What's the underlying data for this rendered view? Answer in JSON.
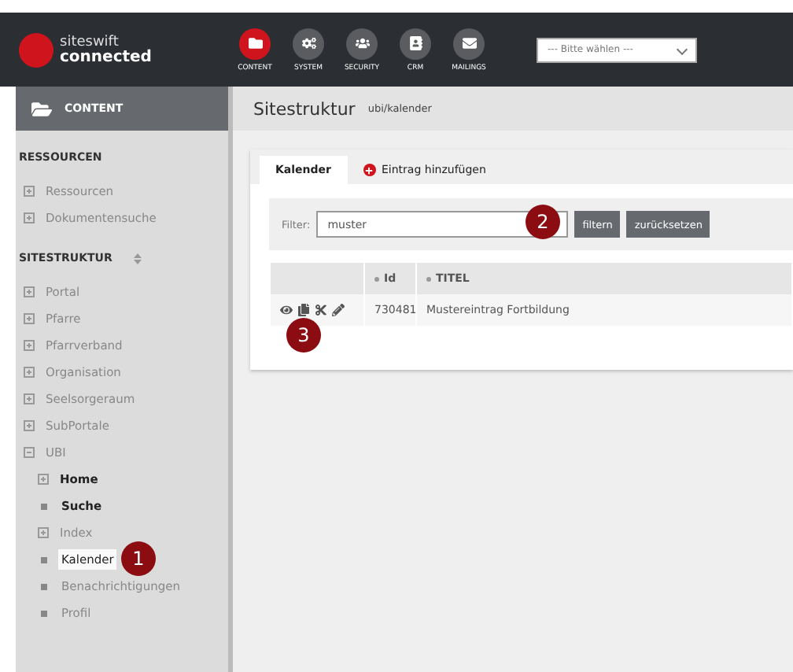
{
  "header": {
    "logo": {
      "line1": "siteswift",
      "line2": "connected"
    },
    "nav": [
      {
        "label": "CONTENT",
        "selected": true
      },
      {
        "label": "SYSTEM",
        "selected": false
      },
      {
        "label": "SECURITY",
        "selected": false
      },
      {
        "label": "CRM",
        "selected": false
      },
      {
        "label": "MAILINGS",
        "selected": false
      }
    ],
    "dropdown": {
      "value": "--- Bitte wählen ---"
    }
  },
  "sidebar": {
    "title": "CONTENT",
    "sections": [
      {
        "heading": "RESSOURCEN",
        "sortable": false,
        "items": [
          {
            "label": "Ressourcen",
            "kind": "expand",
            "bold": false,
            "selected": false
          },
          {
            "label": "Dokumentensuche",
            "kind": "expand",
            "bold": false,
            "selected": false
          }
        ]
      },
      {
        "heading": "SITESTRUKTUR",
        "sortable": true,
        "items": [
          {
            "label": "Portal",
            "kind": "expand",
            "bold": false,
            "selected": false
          },
          {
            "label": "Pfarre",
            "kind": "expand",
            "bold": false,
            "selected": false
          },
          {
            "label": "Pfarrverband",
            "kind": "expand",
            "bold": false,
            "selected": false
          },
          {
            "label": "Organisation",
            "kind": "expand",
            "bold": false,
            "selected": false
          },
          {
            "label": "Seelsorgeraum",
            "kind": "expand",
            "bold": false,
            "selected": false
          },
          {
            "label": "SubPortale",
            "kind": "expand",
            "bold": false,
            "selected": false
          },
          {
            "label": "UBI",
            "kind": "collapse",
            "bold": false,
            "selected": false,
            "children": [
              {
                "label": "Home",
                "kind": "expand",
                "bold": true,
                "selected": false
              },
              {
                "label": "Suche",
                "kind": "leaf",
                "bold": true,
                "selected": false
              },
              {
                "label": "Index",
                "kind": "expand",
                "bold": false,
                "selected": false
              },
              {
                "label": "Kalender",
                "kind": "leaf",
                "bold": false,
                "selected": true
              },
              {
                "label": "Benachrichtigungen",
                "kind": "leaf",
                "bold": false,
                "selected": false
              },
              {
                "label": "Profil",
                "kind": "leaf",
                "bold": false,
                "selected": false
              }
            ]
          }
        ]
      }
    ]
  },
  "content": {
    "title": "Sitestruktur",
    "path": "ubi/kalender",
    "tabs": [
      {
        "label": "Kalender",
        "kind": "tab",
        "selected": true
      },
      {
        "label": "Eintrag hinzufügen",
        "kind": "add",
        "selected": false
      }
    ],
    "filter": {
      "label": "Filter:",
      "value": "muster",
      "buttons": [
        "filtern",
        "zurücksetzen"
      ]
    },
    "table": {
      "columns": [
        "",
        "Id",
        "TITEL"
      ],
      "rows": [
        {
          "id": "730481",
          "title": "Mustereintrag Fortbildung"
        }
      ]
    }
  },
  "callouts": [
    "1",
    "2",
    "3"
  ]
}
